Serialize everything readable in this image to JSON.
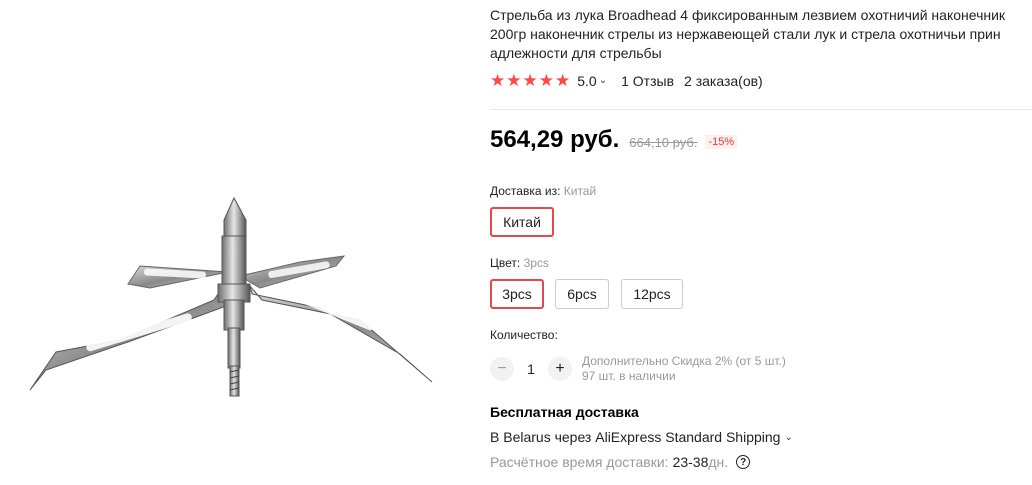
{
  "product": {
    "title": "Стрельба из лука Broadhead 4 фиксированным лезвием охотничий наконечник\n200гр наконечник стрелы из нержавеющей стали лук и стрела охотничьи прин\nадлежности для стрельбы",
    "image_alt": "broadhead-arrowhead-photo"
  },
  "rating": {
    "stars": 5,
    "value": "5.0",
    "reviews": "1 Отзыв",
    "orders": "2 заказа(ов)",
    "star_color": "#ff4747"
  },
  "price": {
    "current": "564,29 руб.",
    "old": "664,10 руб.",
    "discount": "-15%"
  },
  "shipping_from": {
    "label": "Доставка из:",
    "value": "Китай",
    "options": [
      "Китай"
    ]
  },
  "color": {
    "label": "Цвет:",
    "value": "3pcs",
    "options": [
      "3pcs",
      "6pcs",
      "12pcs"
    ],
    "selected_color": "#e54a4a"
  },
  "quantity": {
    "label": "Количество:",
    "value": "1",
    "minus": "−",
    "plus": "+",
    "discount_note": "Дополнительно Скидка 2% (от 5 шт.)",
    "stock": "97 шт. в наличии"
  },
  "delivery": {
    "title": "Бесплатная доставка",
    "method": "В Belarus через AliExpress Standard Shipping",
    "time_label": "Расчётное время доставки:",
    "time_value": "23-38",
    "time_unit": "дн."
  },
  "icons": {
    "chevron": "⌄",
    "help": "?"
  }
}
